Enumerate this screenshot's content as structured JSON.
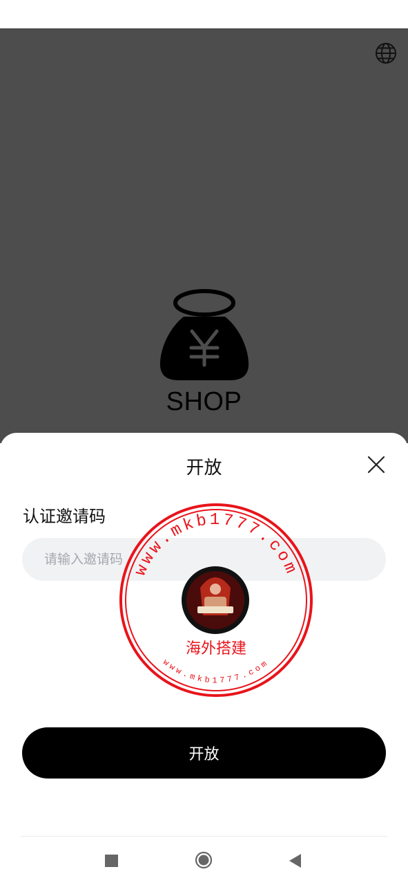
{
  "app": {
    "brand": "SHOP"
  },
  "header": {
    "language_icon": "globe-icon"
  },
  "sheet": {
    "title": "开放",
    "close_icon": "close-icon",
    "field_label": "认证邀请码",
    "input_placeholder": "请输入邀请码",
    "input_value": "",
    "submit_label": "开放"
  },
  "watermark": {
    "url_outer": "www.mkb1777.com",
    "url_inner": "www.mkb1777.com",
    "name": "海外搭建"
  },
  "nav": {
    "recent_icon": "square-icon",
    "home_icon": "circle-icon",
    "back_icon": "triangle-back-icon"
  },
  "colors": {
    "backdrop": "#4d4d4d",
    "button": "#000000",
    "input_bg": "#f1f2f4",
    "stamp": "#e8141b"
  }
}
